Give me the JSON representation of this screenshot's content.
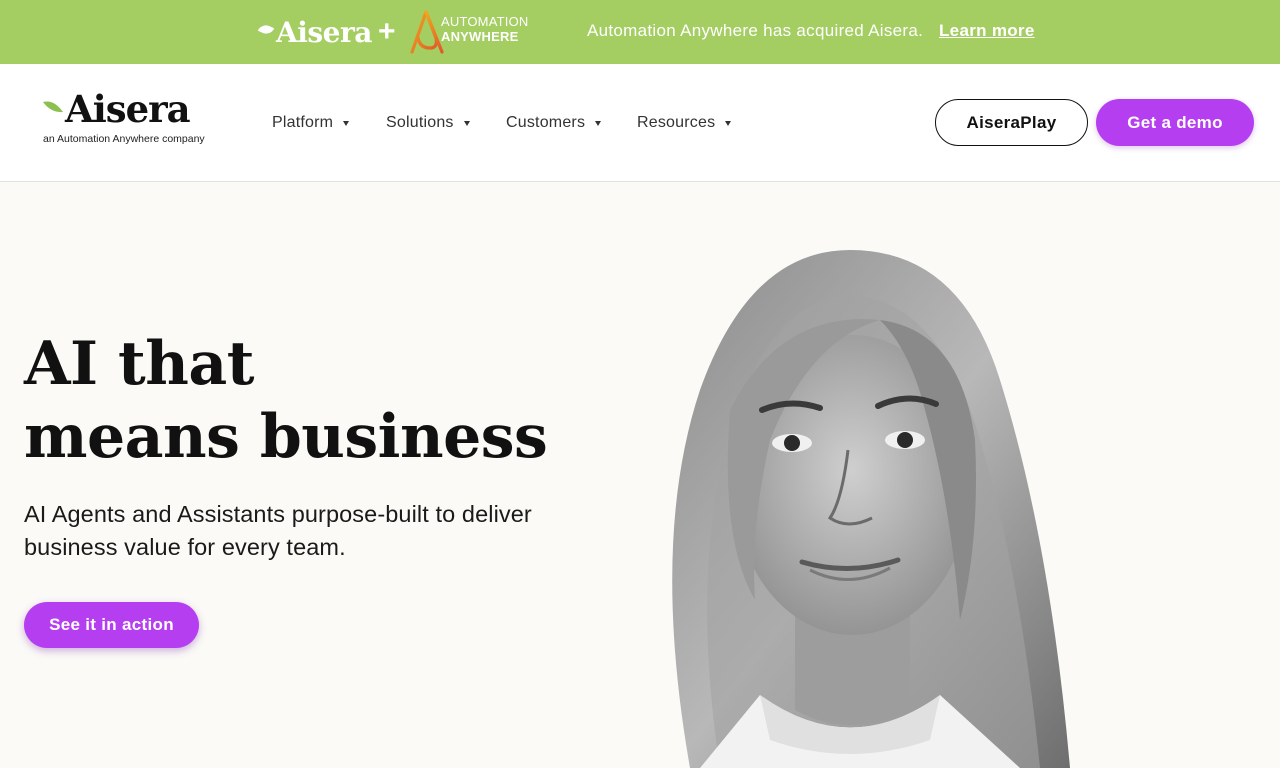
{
  "banner": {
    "brand": "Aisera",
    "plus": "+",
    "partner_line1": "AUTOMATION",
    "partner_line2": "ANYWHERE",
    "message": "Automation Anywhere has acquired Aisera.",
    "link": "Learn more",
    "bg_color": "#a4cd62"
  },
  "header": {
    "logo_word": "Aisera",
    "logo_tagline": "an Automation Anywhere company",
    "nav": [
      {
        "label": "Platform",
        "icon": "caret-down-icon"
      },
      {
        "label": "Solutions",
        "icon": "caret-down-icon"
      },
      {
        "label": "Customers",
        "icon": "caret-down-icon"
      },
      {
        "label": "Resources",
        "icon": "caret-down-icon"
      }
    ],
    "secondary_button": "AiseraPlay",
    "primary_button": "Get a demo",
    "accent_color": "#b53ff0"
  },
  "hero": {
    "title_line1": "AI that",
    "title_line2": "means business",
    "subtitle_line1": "AI Agents and Assistants purpose-built to deliver",
    "subtitle_line2": "business value for every team.",
    "cta": "See it in action",
    "image_subject": "grayscale portrait of a smiling woman with long gray hair"
  }
}
